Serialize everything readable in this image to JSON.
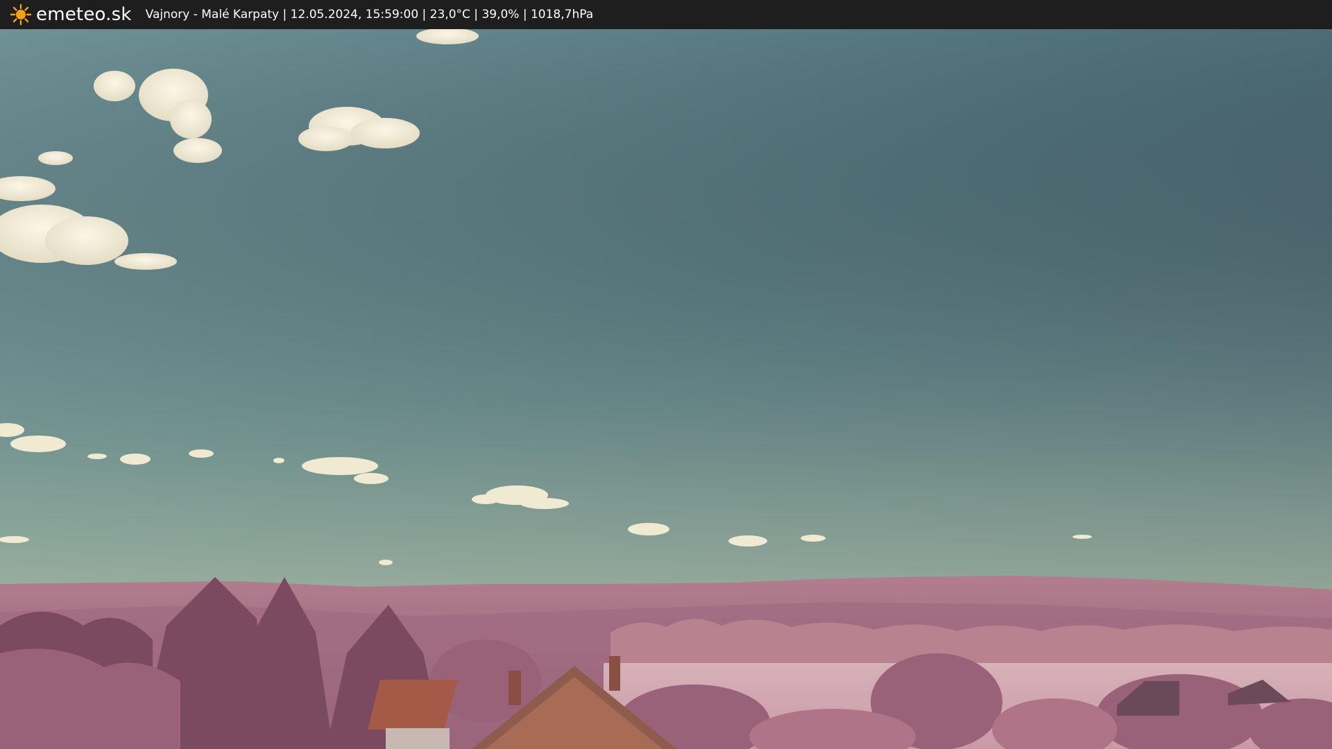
{
  "header": {
    "brand": "emeteo.sk",
    "brand_icon": "sun-icon",
    "info": "Vajnory - Malé Karpaty | 12.05.2024, 15:59:00 | 23,0°C | 39,0% | 1018,7hPa"
  },
  "colors": {
    "bar_background": "#1e1e1e",
    "sun": "#f5a21b",
    "sky_top": "#3b4f5e",
    "sky_horizon": "#85ab9e",
    "vegetation": "#a96a82",
    "clouds": "#f0ead6"
  }
}
